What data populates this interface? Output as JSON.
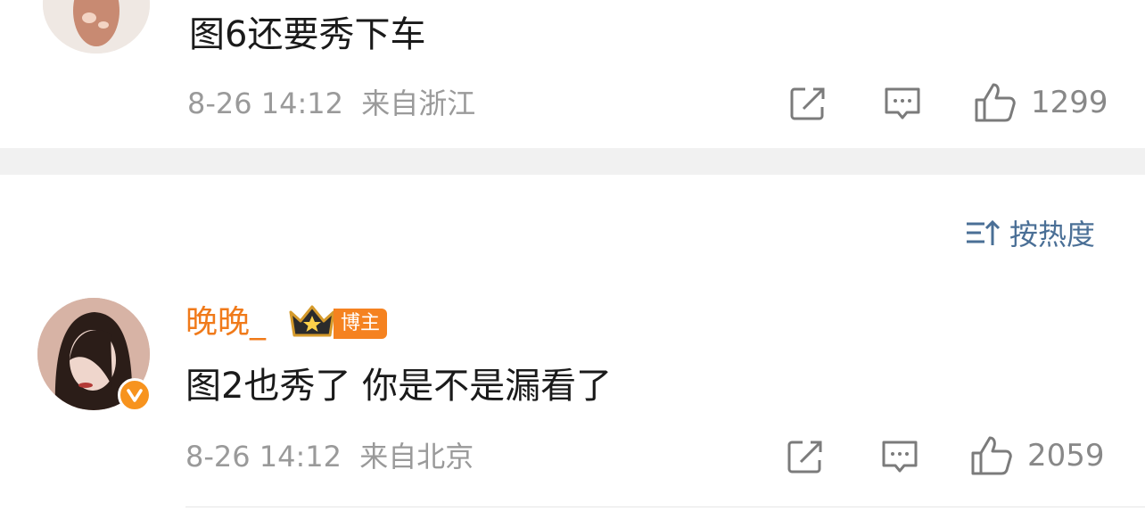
{
  "comments": [
    {
      "text": "图6还要秀下车",
      "time": "8-26 14:12",
      "location": "来自浙江",
      "likes": "1299"
    },
    {
      "username": "晚晚_",
      "badge": "博主",
      "text": "图2也秀了 你是不是漏看了",
      "time": "8-26 14:12",
      "location": "来自北京",
      "likes": "2059"
    }
  ],
  "sort": {
    "label": "按热度",
    "icon": "sort-icon"
  },
  "icons": [
    "share-icon",
    "comment-icon",
    "like-icon",
    "crown-icon",
    "verified-icon"
  ],
  "colors": {
    "username": "#f07a1a",
    "badge_bg": "#f58220",
    "sort_text": "#4a6f96",
    "meta_text": "#9a9a9a",
    "separator": "#f1f1f1"
  }
}
